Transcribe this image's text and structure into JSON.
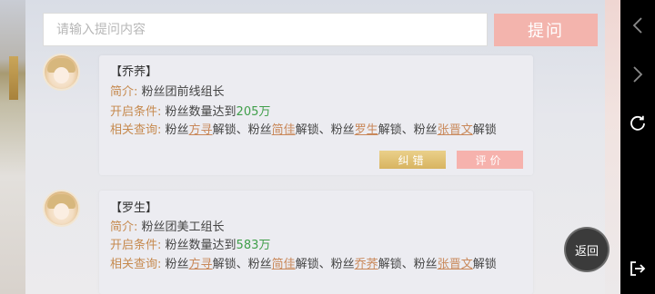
{
  "search": {
    "placeholder": "请输入提问内容",
    "value": ""
  },
  "ask_button": {
    "label": "提问"
  },
  "entries": [
    {
      "name": "【乔荞】",
      "intro_label": "简介:",
      "intro_value": "粉丝团前线组长",
      "cond_label": "开启条件:",
      "cond_text": "粉丝数量达到",
      "cond_number": "205万",
      "related_label": "相关查询:",
      "related": [
        {
          "prefix": "粉丝",
          "link": "方寻",
          "suffix": "解锁、"
        },
        {
          "prefix": "粉丝",
          "link": "简佳",
          "suffix": "解锁、"
        },
        {
          "prefix": "粉丝",
          "link": "罗生",
          "suffix": "解锁、"
        },
        {
          "prefix": "粉丝",
          "link": "张晋文",
          "suffix": "解锁"
        }
      ],
      "report_label": "纠错",
      "rate_label": "评价"
    },
    {
      "name": "【罗生】",
      "intro_label": "简介:",
      "intro_value": "粉丝团美工组长",
      "cond_label": "开启条件:",
      "cond_text": "粉丝数量达到",
      "cond_number": "583万",
      "related_label": "相关查询:",
      "related": [
        {
          "prefix": "粉丝",
          "link": "方寻",
          "suffix": "解锁、"
        },
        {
          "prefix": "粉丝",
          "link": "简佳",
          "suffix": "解锁、"
        },
        {
          "prefix": "粉丝",
          "link": "乔荞",
          "suffix": "解锁、"
        },
        {
          "prefix": "粉丝",
          "link": "张晋文",
          "suffix": "解锁"
        }
      ]
    }
  ],
  "back_button": {
    "label": "返回"
  },
  "nav_icons": [
    "chevron-left-icon",
    "chevron-right-icon",
    "refresh-icon",
    "exit-icon"
  ],
  "colors": {
    "label": "#c68a4f",
    "number": "#3f9e49",
    "link": "#c9885a",
    "ask": "#f3b4ad",
    "report": "#d8b461",
    "rate": "#f6b2ad"
  }
}
